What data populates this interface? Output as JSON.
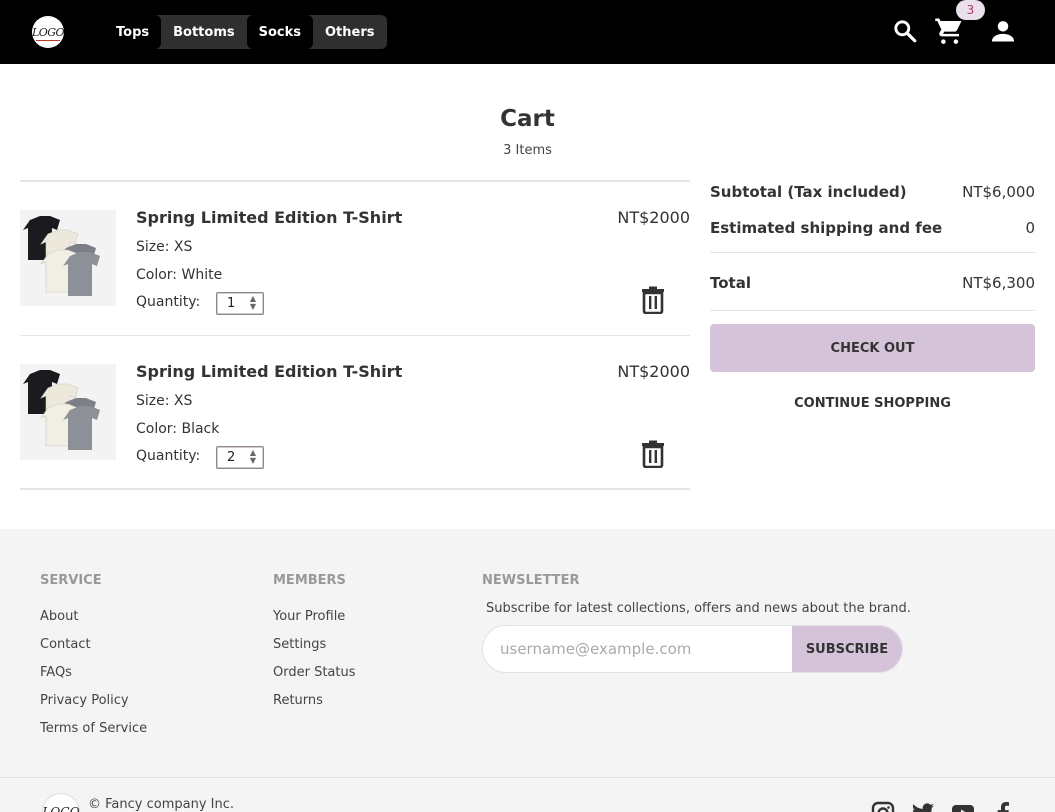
{
  "header": {
    "logo_text": "LOGO",
    "nav": [
      "Tops",
      "Bottoms",
      "Socks",
      "Others"
    ],
    "cart_badge": "3",
    "icons": [
      "search-icon",
      "cart-icon",
      "account-icon"
    ]
  },
  "cart": {
    "title": "Cart",
    "count_label": "3 Items",
    "items": [
      {
        "name": "Spring Limited Edition T-Shirt",
        "size": "Size: XS",
        "color": "Color: White",
        "quantity_label": "Quantity:",
        "quantity": "1",
        "price": "NT$2000"
      },
      {
        "name": "Spring Limited Edition T-Shirt",
        "size": "Size: XS",
        "color": "Color: Black",
        "quantity_label": "Quantity:",
        "quantity": "2",
        "price": "NT$2000"
      }
    ]
  },
  "summary": {
    "subtotal_label": "Subtotal (Tax included)",
    "subtotal_value": "NT$6,000",
    "shipping_label": "Estimated shipping and fee",
    "shipping_value": "0",
    "total_label": "Total",
    "total_value": "NT$6,300",
    "checkout_label": "CHECK OUT",
    "continue_label": "CONTINUE SHOPPING"
  },
  "footer": {
    "service": {
      "heading": "SERVICE",
      "links": [
        "About",
        "Contact",
        "FAQs",
        "Privacy Policy",
        "Terms of Service"
      ]
    },
    "members": {
      "heading": "MEMBERS",
      "links": [
        "Your Profile",
        "Settings",
        "Order Status",
        "Returns"
      ]
    },
    "newsletter": {
      "heading": "NEWSLETTER",
      "text": "Subscribe for latest collections, offers and news about the brand.",
      "placeholder": "username@example.com",
      "button": "SUBSCRIBE"
    },
    "copyright": "© Fancy company Inc.",
    "logo_text": "LOGO",
    "social_icons": [
      "instagram-icon",
      "twitter-icon",
      "youtube-icon",
      "facebook-icon"
    ]
  },
  "colors": {
    "accent": "#d5c3d9",
    "header_bg": "#000000",
    "footer_bg": "#f4f4f4"
  }
}
